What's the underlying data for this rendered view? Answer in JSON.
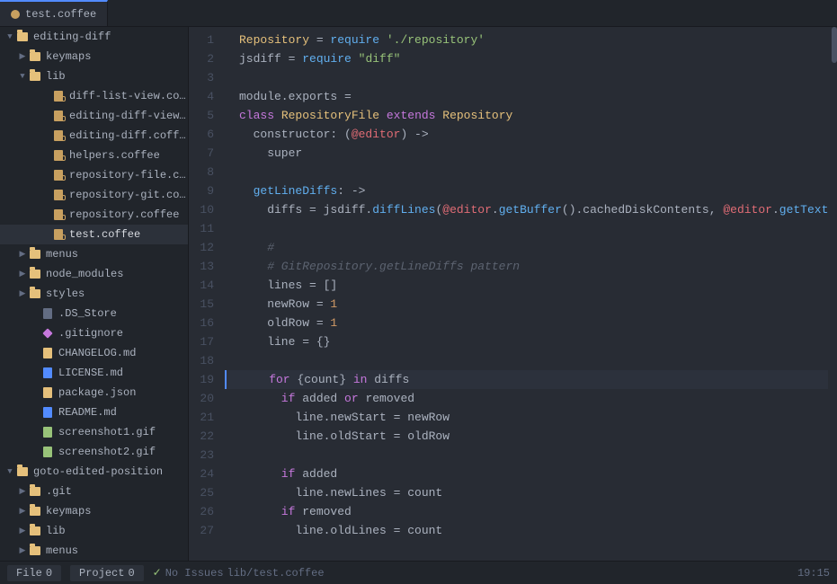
{
  "title": "editing-diff",
  "tab": {
    "label": "test.coffee",
    "icon": "coffee-icon"
  },
  "sidebar": {
    "root": "editing-diff",
    "items": [
      {
        "id": "keymaps",
        "label": "keymaps",
        "type": "folder",
        "depth": 1,
        "open": false
      },
      {
        "id": "lib",
        "label": "lib",
        "type": "folder",
        "depth": 1,
        "open": true
      },
      {
        "id": "diff-list-view",
        "label": "diff-list-view.coffee",
        "type": "coffee",
        "depth": 3
      },
      {
        "id": "editing-diff-view",
        "label": "editing-diff-view.coff...",
        "type": "coffee",
        "depth": 3
      },
      {
        "id": "editing-diff",
        "label": "editing-diff.coffee",
        "type": "coffee",
        "depth": 3
      },
      {
        "id": "helpers",
        "label": "helpers.coffee",
        "type": "coffee",
        "depth": 3
      },
      {
        "id": "repository-file",
        "label": "repository-file.coffee",
        "type": "coffee",
        "depth": 3
      },
      {
        "id": "repository-git",
        "label": "repository-git.coffee",
        "type": "coffee",
        "depth": 3
      },
      {
        "id": "repository",
        "label": "repository.coffee",
        "type": "coffee",
        "depth": 3
      },
      {
        "id": "test",
        "label": "test.coffee",
        "type": "coffee",
        "depth": 3,
        "selected": true
      },
      {
        "id": "menus",
        "label": "menus",
        "type": "folder",
        "depth": 1,
        "open": false
      },
      {
        "id": "node_modules",
        "label": "node_modules",
        "type": "folder",
        "depth": 1,
        "open": false
      },
      {
        "id": "styles",
        "label": "styles",
        "type": "folder",
        "depth": 1,
        "open": false
      },
      {
        "id": ".DS_Store",
        "label": ".DS_Store",
        "type": "ds",
        "depth": 2
      },
      {
        "id": ".gitignore",
        "label": ".gitignore",
        "type": "diamond",
        "depth": 2
      },
      {
        "id": "CHANGELOG.md",
        "label": "CHANGELOG.md",
        "type": "changelog",
        "depth": 2
      },
      {
        "id": "LICENSE.md",
        "label": "LICENSE.md",
        "type": "md",
        "depth": 2
      },
      {
        "id": "package.json",
        "label": "package.json",
        "type": "json",
        "depth": 2
      },
      {
        "id": "README.md",
        "label": "README.md",
        "type": "md",
        "depth": 2
      },
      {
        "id": "screenshot1.gif",
        "label": "screenshot1.gif",
        "type": "img",
        "depth": 2
      },
      {
        "id": "screenshot2.gif",
        "label": "screenshot2.gif",
        "type": "img",
        "depth": 2
      },
      {
        "id": "goto-edited-position",
        "label": "goto-edited-position",
        "type": "folder-root",
        "depth": 0,
        "open": true
      },
      {
        "id": ".git",
        "label": ".git",
        "type": "folder",
        "depth": 1,
        "open": false
      },
      {
        "id": "keymaps2",
        "label": "keymaps",
        "type": "folder",
        "depth": 1,
        "open": false
      },
      {
        "id": "lib2",
        "label": "lib",
        "type": "folder",
        "depth": 1,
        "open": false
      },
      {
        "id": "menus2",
        "label": "menus",
        "type": "folder",
        "depth": 1,
        "open": false
      }
    ]
  },
  "code": {
    "lines": [
      {
        "num": 1,
        "tokens": [
          {
            "t": "cls",
            "v": "Repository"
          },
          {
            "t": "plain",
            "v": " = "
          },
          {
            "t": "fn",
            "v": "require"
          },
          {
            "t": "plain",
            "v": " "
          },
          {
            "t": "str",
            "v": "'./repository'"
          }
        ]
      },
      {
        "num": 2,
        "tokens": [
          {
            "t": "plain",
            "v": "jsdiff = "
          },
          {
            "t": "fn",
            "v": "require"
          },
          {
            "t": "plain",
            "v": " "
          },
          {
            "t": "str",
            "v": "\"diff\""
          }
        ]
      },
      {
        "num": 3,
        "tokens": []
      },
      {
        "num": 4,
        "tokens": [
          {
            "t": "plain",
            "v": "module.exports ="
          }
        ]
      },
      {
        "num": 5,
        "tokens": [
          {
            "t": "kw",
            "v": "class"
          },
          {
            "t": "plain",
            "v": " "
          },
          {
            "t": "cls",
            "v": "RepositoryFile"
          },
          {
            "t": "plain",
            "v": " "
          },
          {
            "t": "kw",
            "v": "extends"
          },
          {
            "t": "plain",
            "v": " "
          },
          {
            "t": "cls",
            "v": "Repository"
          }
        ]
      },
      {
        "num": 6,
        "tokens": [
          {
            "t": "plain",
            "v": "  constructor: ("
          },
          {
            "t": "var",
            "v": "@editor"
          },
          {
            "t": "plain",
            "v": ") ->"
          }
        ]
      },
      {
        "num": 7,
        "tokens": [
          {
            "t": "plain",
            "v": "    super"
          }
        ]
      },
      {
        "num": 8,
        "tokens": []
      },
      {
        "num": 9,
        "tokens": [
          {
            "t": "fn",
            "v": "  getLineDiffs"
          },
          {
            "t": "plain",
            "v": ": ->"
          }
        ]
      },
      {
        "num": 10,
        "tokens": [
          {
            "t": "plain",
            "v": "    diffs = jsdiff."
          },
          {
            "t": "fn",
            "v": "diffLines"
          },
          {
            "t": "plain",
            "v": "("
          },
          {
            "t": "var",
            "v": "@editor"
          },
          {
            "t": "plain",
            "v": "."
          },
          {
            "t": "fn",
            "v": "getBuffer"
          },
          {
            "t": "plain",
            "v": "().cachedDiskContents, "
          },
          {
            "t": "var",
            "v": "@editor"
          },
          {
            "t": "plain",
            "v": "."
          },
          {
            "t": "fn",
            "v": "getText"
          },
          {
            "t": "plain",
            "v": "())"
          }
        ]
      },
      {
        "num": 11,
        "tokens": []
      },
      {
        "num": 12,
        "tokens": [
          {
            "t": "cm",
            "v": "    #"
          }
        ]
      },
      {
        "num": 13,
        "tokens": [
          {
            "t": "cm",
            "v": "    # GitRepository.getLineDiffs pattern"
          }
        ]
      },
      {
        "num": 14,
        "tokens": [
          {
            "t": "plain",
            "v": "    lines = []"
          }
        ]
      },
      {
        "num": 15,
        "tokens": [
          {
            "t": "plain",
            "v": "    newRow = "
          },
          {
            "t": "num",
            "v": "1"
          }
        ]
      },
      {
        "num": 16,
        "tokens": [
          {
            "t": "plain",
            "v": "    oldRow = "
          },
          {
            "t": "num",
            "v": "1"
          }
        ]
      },
      {
        "num": 17,
        "tokens": [
          {
            "t": "plain",
            "v": "    line = {}"
          }
        ]
      },
      {
        "num": 18,
        "tokens": []
      },
      {
        "num": 19,
        "tokens": [
          {
            "t": "kw",
            "v": "    for"
          },
          {
            "t": "plain",
            "v": " {count} "
          },
          {
            "t": "kw",
            "v": "in"
          },
          {
            "t": "plain",
            "v": " diffs"
          }
        ],
        "highlighted": true
      },
      {
        "num": 20,
        "tokens": [
          {
            "t": "kw",
            "v": "      if"
          },
          {
            "t": "plain",
            "v": " added "
          },
          {
            "t": "kw",
            "v": "or"
          },
          {
            "t": "plain",
            "v": " removed"
          }
        ]
      },
      {
        "num": 21,
        "tokens": [
          {
            "t": "plain",
            "v": "        line.newStart = newRow"
          }
        ]
      },
      {
        "num": 22,
        "tokens": [
          {
            "t": "plain",
            "v": "        line.oldStart = oldRow"
          }
        ]
      },
      {
        "num": 23,
        "tokens": []
      },
      {
        "num": 24,
        "tokens": [
          {
            "t": "kw",
            "v": "      if"
          },
          {
            "t": "plain",
            "v": " added"
          }
        ]
      },
      {
        "num": 25,
        "tokens": [
          {
            "t": "plain",
            "v": "        line.newLines = count"
          }
        ]
      },
      {
        "num": 26,
        "tokens": [
          {
            "t": "kw",
            "v": "      if"
          },
          {
            "t": "plain",
            "v": " removed"
          }
        ]
      },
      {
        "num": 27,
        "tokens": [
          {
            "t": "plain",
            "v": "        line.oldLines = count"
          }
        ]
      }
    ]
  },
  "status": {
    "file_label": "File",
    "file_count": "0",
    "project_label": "Project",
    "project_count": "0",
    "no_issues_label": "No Issues",
    "path": "lib/test.coffee",
    "position": "19:15"
  }
}
